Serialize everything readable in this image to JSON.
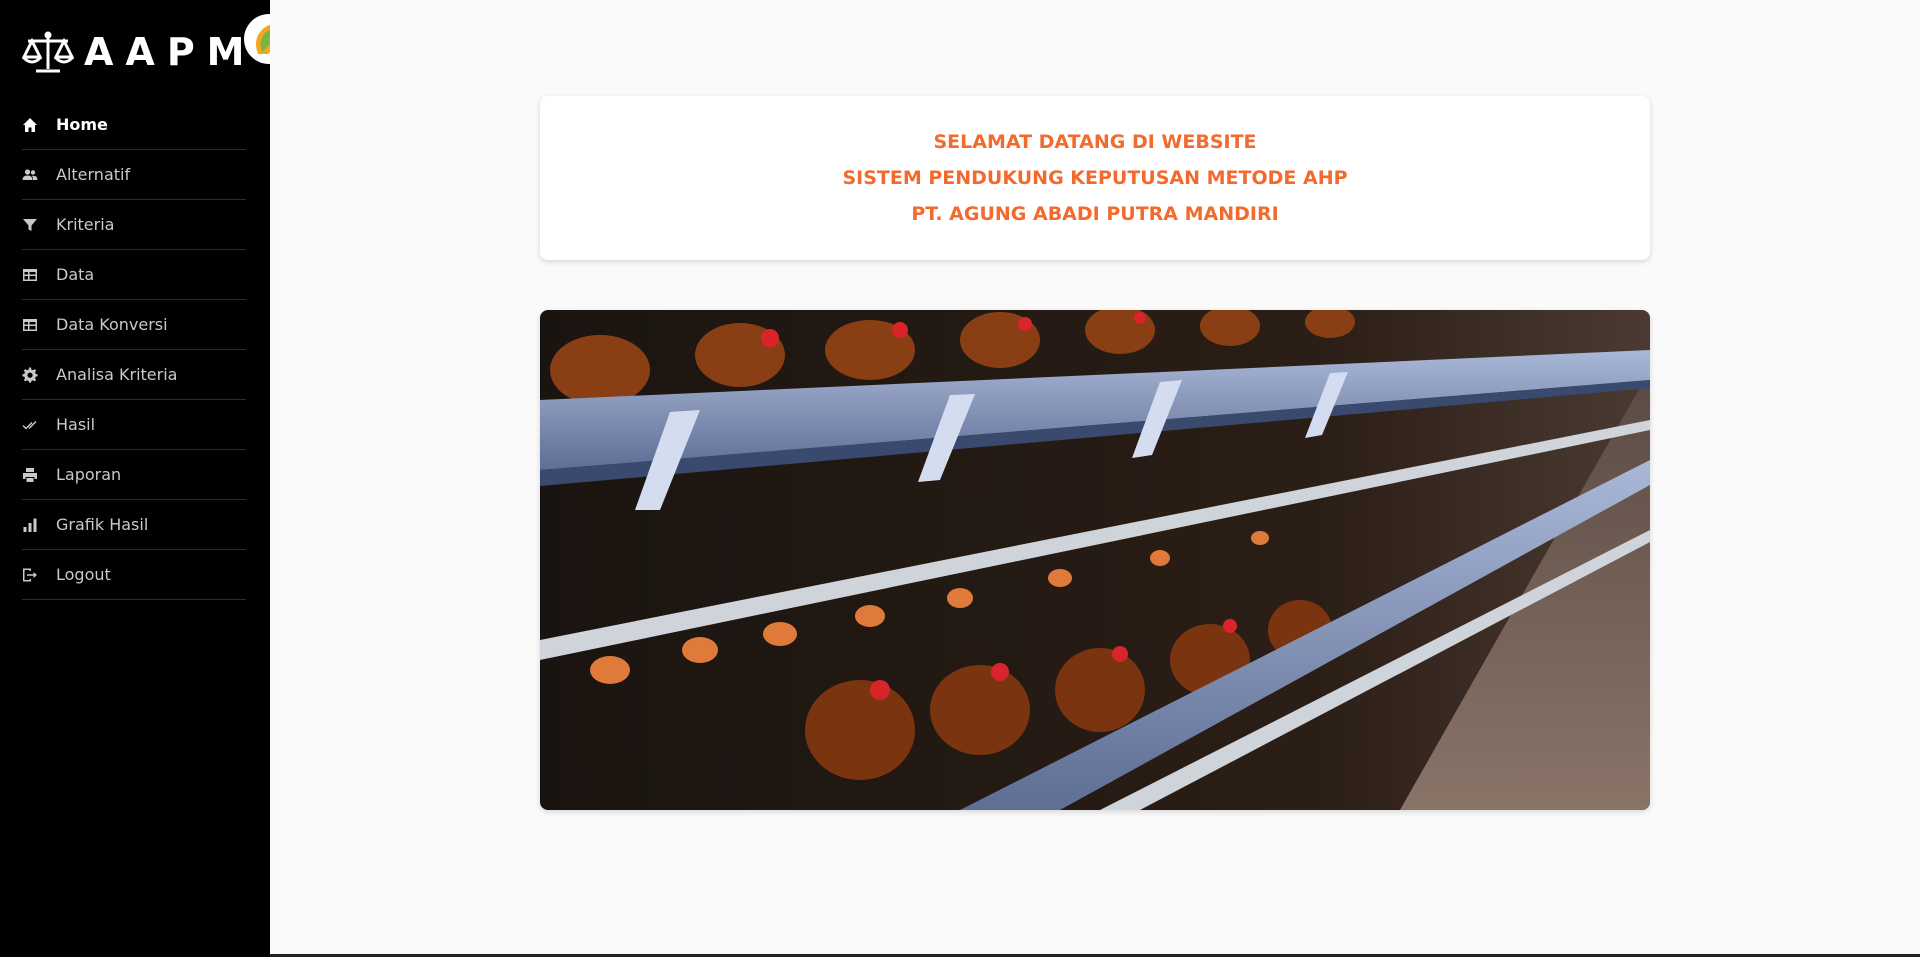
{
  "brand": {
    "name": "AAPM",
    "scale_icon": "balance-scale-icon",
    "logo_icon": "rooster-logo-icon"
  },
  "sidebar": {
    "items": [
      {
        "label": "Home",
        "icon": "home-icon",
        "active": true
      },
      {
        "label": "Alternatif",
        "icon": "users-icon"
      },
      {
        "label": "Kriteria",
        "icon": "filter-icon"
      },
      {
        "label": "Data",
        "icon": "table-icon"
      },
      {
        "label": "Data Konversi",
        "icon": "table-icon"
      },
      {
        "label": "Analisa Kriteria",
        "icon": "gear-icon"
      },
      {
        "label": "Hasil",
        "icon": "double-check-icon"
      },
      {
        "label": "Laporan",
        "icon": "printer-icon"
      },
      {
        "label": "Grafik Hasil",
        "icon": "bar-chart-icon"
      },
      {
        "label": "Logout",
        "icon": "logout-icon"
      }
    ]
  },
  "welcome": {
    "line1": "SELAMAT DATANG DI WEBSITE",
    "line2": "SISTEM PENDUKUNG KEPUTUSAN METODE AHP",
    "line3": "PT. AGUNG ABADI PUTRA MANDIRI"
  },
  "colors": {
    "accent": "#f26a2e",
    "sidebar_bg": "#000000",
    "page_bg": "#fafafa"
  }
}
